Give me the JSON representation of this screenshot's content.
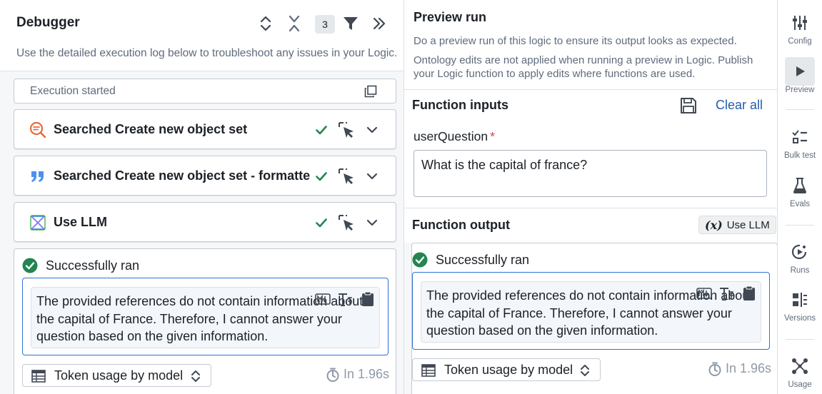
{
  "debugger": {
    "title": "Debugger",
    "description": "Use the detailed execution log below to troubleshoot any issues in your Logic.",
    "filter_count": "3",
    "execution_started": "Execution started",
    "steps": [
      {
        "label": "Searched Create new object set",
        "icon": "search-doc-icon",
        "status": "success"
      },
      {
        "label": "Searched Create new object set - formatte",
        "icon": "quote-icon",
        "status": "success"
      },
      {
        "label": "Use LLM",
        "icon": "llm-icon",
        "status": "success"
      }
    ],
    "result": {
      "status": "Successfully ran",
      "output": "The provided references do not contain information about the capital of France. Therefore, I cannot answer your question based on the given information.",
      "token_usage_label": "Token usage by model",
      "duration": "In 1.96s"
    }
  },
  "preview": {
    "title": "Preview run",
    "description": "Do a preview run of this logic to ensure its output looks as expected.",
    "note": "Ontology edits are not applied when running a preview in Logic. Publish your Logic function to apply edits where functions are used.",
    "inputs_title": "Function inputs",
    "clear_all": "Clear all",
    "param_label": "userQuestion",
    "param_required": "*",
    "param_value": "What is the capital of france?",
    "output_title": "Function output",
    "output_tag": "Use LLM",
    "output_tag_fx": "(x)",
    "result": {
      "status": "Successfully ran",
      "output": "The provided references do not contain information about the capital of France. Therefore, I cannot answer your question based on the given information.",
      "token_usage_label": "Token usage by model",
      "duration": "In 1.96s"
    }
  },
  "rail": {
    "items": [
      {
        "label": "Config",
        "icon": "sliders-icon"
      },
      {
        "label": "Preview",
        "icon": "play-icon"
      },
      {
        "label": "Bulk test",
        "icon": "checklist-icon"
      },
      {
        "label": "Evals",
        "icon": "flask-icon"
      },
      {
        "label": "Runs",
        "icon": "runs-icon"
      },
      {
        "label": "Versions",
        "icon": "versions-icon"
      },
      {
        "label": "Usage",
        "icon": "graph-icon"
      }
    ]
  },
  "colors": {
    "success": "#238551",
    "link": "#215db0",
    "focus_border": "#2d72d2",
    "search_icon": "#e76a3a",
    "quote_icon": "#4c90f0"
  }
}
